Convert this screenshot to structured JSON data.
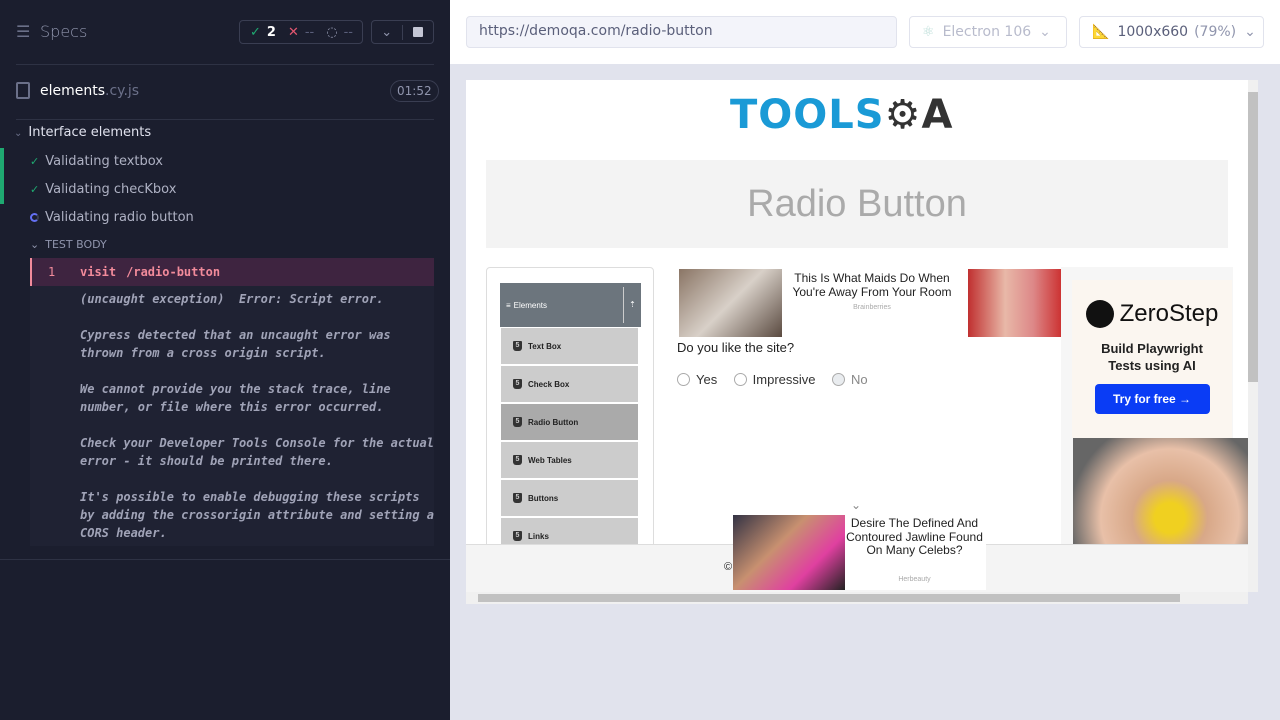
{
  "runner": {
    "title": "Specs",
    "passed": "2",
    "failed": "--",
    "pending": "--",
    "spec_name": "elements",
    "spec_ext": ".cy.js",
    "duration": "01:52",
    "suite": "Interface elements",
    "tests": [
      {
        "label": "Validating textbox",
        "status": "passed"
      },
      {
        "label": "Validating checKbox",
        "status": "passed"
      },
      {
        "label": "Validating radio button",
        "status": "running"
      }
    ],
    "test_body_label": "TEST BODY",
    "command": {
      "num": "1",
      "name": "visit",
      "arg": "/radio-button"
    },
    "error": "(uncaught exception)  Error: Script error.\n\nCypress detected that an uncaught error was thrown from a cross origin script.\n\nWe cannot provide you the stack trace, line number, or file where this error occurred.\n\nCheck your Developer Tools Console for the actual error - it should be printed there.\n\nIt's possible to enable debugging these scripts by adding the crossorigin attribute and setting a CORS header.",
    "colors": {
      "pass": "#1fa971",
      "fail": "#e45770",
      "running": "#6470f3",
      "bg": "#1b1e2e"
    }
  },
  "browser": {
    "url": "https://demoqa.com/radio-button",
    "browser": "Electron 106",
    "viewport": "1000x660",
    "scale": "(79%)"
  },
  "page": {
    "logo": "TOOLSQA",
    "heading": "Radio Button",
    "nav_header": "Elements",
    "nav_items": [
      "Text Box",
      "Check Box",
      "Radio Button",
      "Web Tables",
      "Buttons",
      "Links"
    ],
    "active_nav": "Radio Button",
    "question": "Do you like the site?",
    "options": [
      {
        "label": "Yes",
        "disabled": false
      },
      {
        "label": "Impressive",
        "disabled": false
      },
      {
        "label": "No",
        "disabled": true
      }
    ],
    "ad1": {
      "title": "This Is What Maids Do When You're Away From Your Room",
      "source": "Brainberries"
    },
    "ad2": {
      "title": "Desire The Defined And Contoured Jawline Found On Many Celebs?",
      "source": "Herbeauty"
    },
    "ad3": {
      "brand": "ZeroStep",
      "text": "Build Playwright Tests using AI",
      "cta": "Try for free →"
    },
    "footer": "©"
  }
}
